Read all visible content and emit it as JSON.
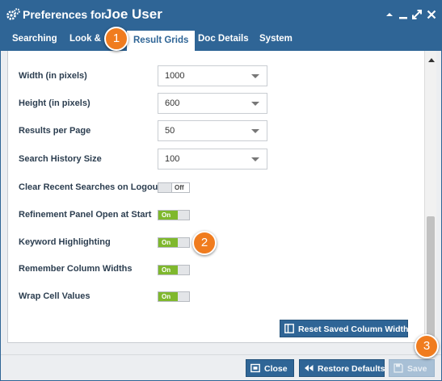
{
  "window": {
    "title_prefix": "Preferences for",
    "user_name": "Joe User",
    "controls": [
      "minimize-icon",
      "restore-icon",
      "expand-icon",
      "close-icon"
    ]
  },
  "tabs": [
    {
      "label": "Searching",
      "active": false
    },
    {
      "label": "Look &",
      "active": false
    },
    {
      "label": "Result Grids",
      "active": true
    },
    {
      "label": "Doc Details",
      "active": false
    },
    {
      "label": "System",
      "active": false
    }
  ],
  "settings": {
    "width": {
      "label": "Width (in pixels)",
      "value": "1000"
    },
    "height": {
      "label": "Height (in pixels)",
      "value": "600"
    },
    "results_per_page": {
      "label": "Results per Page",
      "value": "50"
    },
    "search_history": {
      "label": "Search History Size",
      "value": "100"
    },
    "clear_recent": {
      "label": "Clear Recent Searches on Logout",
      "state": "Off"
    },
    "refinement_panel": {
      "label": "Refinement Panel Open at Start",
      "state": "On"
    },
    "keyword_highlighting": {
      "label": "Keyword Highlighting",
      "state": "On"
    },
    "remember_widths": {
      "label": "Remember Column Widths",
      "state": "On"
    },
    "wrap_cells": {
      "label": "Wrap Cell Values",
      "state": "On"
    }
  },
  "buttons": {
    "reset_widths": "Reset Saved Column Widths",
    "close": "Close",
    "restore_defaults": "Restore Defaults",
    "save": "Save"
  },
  "callouts": [
    "1",
    "2",
    "3"
  ],
  "colors": {
    "primary": "#2f6596",
    "toggle_on": "#7fb82d",
    "callout": "#f07c1f"
  }
}
